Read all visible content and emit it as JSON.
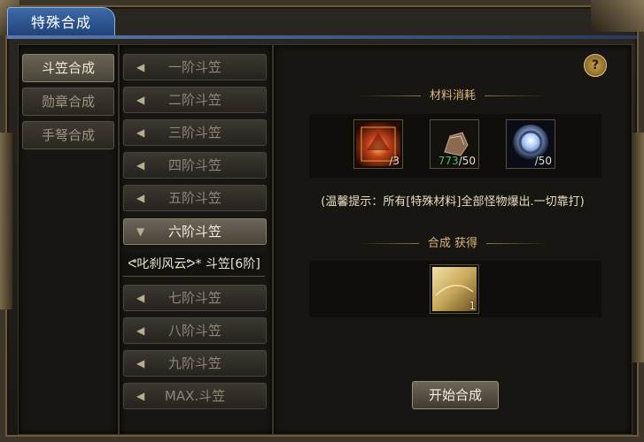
{
  "window": {
    "title": "特殊合成"
  },
  "categories": [
    {
      "label": "斗笠合成",
      "active": true
    },
    {
      "label": "勋章合成",
      "active": false
    },
    {
      "label": "手弩合成",
      "active": false
    }
  ],
  "tiers": [
    {
      "label": "一阶斗笠",
      "open": false
    },
    {
      "label": "二阶斗笠",
      "open": false
    },
    {
      "label": "三阶斗笠",
      "open": false
    },
    {
      "label": "四阶斗笠",
      "open": false
    },
    {
      "label": "五阶斗笠",
      "open": false
    },
    {
      "label": "六阶斗笠",
      "open": true
    },
    {
      "label": "七阶斗笠",
      "open": false
    },
    {
      "label": "八阶斗笠",
      "open": false
    },
    {
      "label": "九阶斗笠",
      "open": false
    },
    {
      "label": "MAX.斗笠",
      "open": false
    }
  ],
  "sub_item": {
    "label": "ᕙ叱刹风云ᕗ* 斗笠[6阶]"
  },
  "help": {
    "label": "?"
  },
  "materials": {
    "title": "材料消耗",
    "items": [
      {
        "icon": "fire-armor-icon",
        "have": "",
        "need": "/3"
      },
      {
        "icon": "ore-stone-icon",
        "have": "773",
        "need": "/50"
      },
      {
        "icon": "glowing-orb-icon",
        "have": "",
        "need": "/50"
      }
    ]
  },
  "tip": "(温馨提示：所有[特殊材料]全部怪物爆出.一切靠打)",
  "result": {
    "title": "合成 获得",
    "item": {
      "icon": "golden-hat-icon",
      "count": "1"
    }
  },
  "start_button": {
    "label": "开始合成"
  },
  "arrows": {
    "collapsed": "◀",
    "expanded": "▼"
  },
  "colors": {
    "accent_gold": "#d7b77a",
    "have_green": "#4ec35a",
    "title_blue": "#2f5a98"
  }
}
